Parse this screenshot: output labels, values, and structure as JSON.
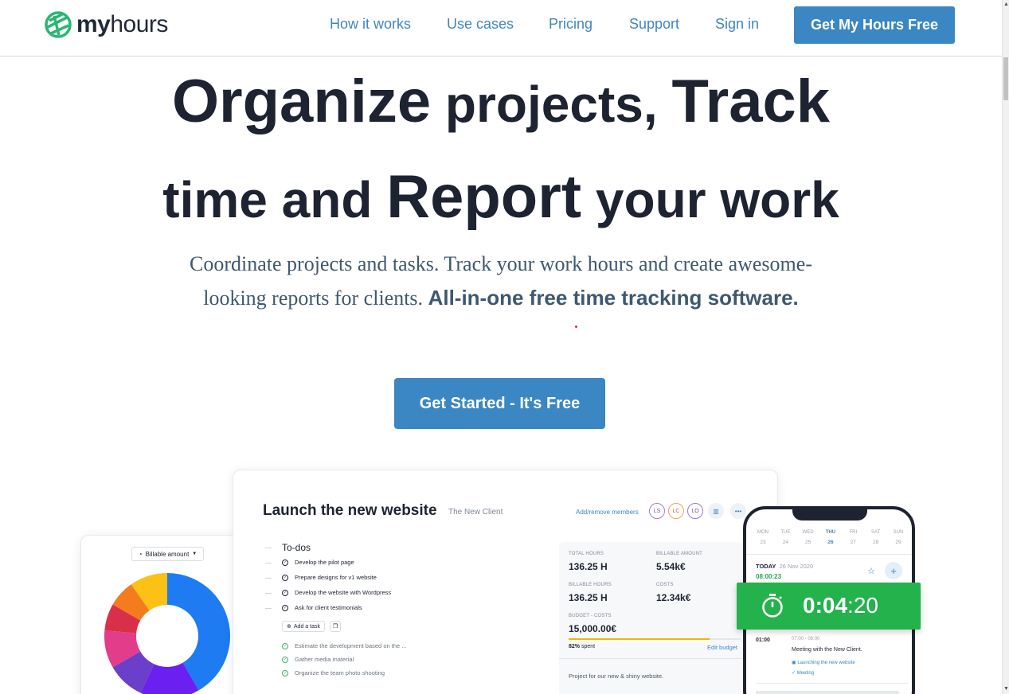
{
  "header": {
    "logo_bold": "my",
    "logo_light": "hours",
    "nav": [
      {
        "label": "How it works"
      },
      {
        "label": "Use cases"
      },
      {
        "label": "Pricing"
      },
      {
        "label": "Support"
      },
      {
        "label": "Sign in"
      }
    ],
    "cta": "Get My Hours Free"
  },
  "hero": {
    "line1_a": "Organize",
    "line1_b": " projects, ",
    "line1_c": "Track",
    "line2_a": "time and ",
    "line2_b": "Report",
    "line2_c": " your work",
    "subtitle_1": "Coordinate projects and tasks. Track your work hours and create awesome-",
    "subtitle_2": "looking reports for clients. ",
    "subtitle_bold": "All-in-one free time tracking software.",
    "cta": "Get Started - It's Free"
  },
  "mock": {
    "project_title": "Launch the new website",
    "client": "The New Client",
    "members_link": "Add/remove members",
    "avatars": [
      "LS",
      "LC",
      "LO"
    ],
    "todo_heading": "To-dos",
    "todos_open": [
      "Develop the pilot page",
      "Prepare designs for v1 website",
      "Develop the website with Wordpress",
      "Ask for client testimonials"
    ],
    "add_task": "Add a task",
    "todos_done": [
      "Estimate the development based on the ...",
      "Gather media material",
      "Organize the team photo shooting"
    ],
    "stats": {
      "total_hours_label": "TOTAL HOURS",
      "total_hours": "136.25 H",
      "billable_amount_label": "BILLABLE AMOUNT",
      "billable_amount": "5.54k€",
      "billable_hours_label": "BILLABLE HOURS",
      "billable_hours": "136.25 H",
      "costs_label": "COSTS",
      "costs": "12.34k€",
      "budget_label": "BUDGET - COSTS",
      "budget": "15,000.00€",
      "spent_pct": "82%",
      "spent_word": " spent",
      "spent_fraction": 0.82,
      "edit_budget": "Edit budget",
      "project_desc": "Project for our new & shiny website."
    },
    "donut_select": "Billable amount",
    "donut_colors": [
      "#1e7bf2",
      "#6b1ff0",
      "#6a3fc9",
      "#e23d8a",
      "#d9304a",
      "#f57b1f",
      "#fbc114",
      "#1e7bf2"
    ]
  },
  "phone": {
    "week": [
      {
        "day": "MON",
        "num": "23"
      },
      {
        "day": "TUE",
        "num": "24"
      },
      {
        "day": "WED",
        "num": "25"
      },
      {
        "day": "THU",
        "num": "26",
        "active": true
      },
      {
        "day": "FRI",
        "num": "27"
      },
      {
        "day": "SAT",
        "num": "28"
      },
      {
        "day": "SUN",
        "num": "29"
      }
    ],
    "today_label": "TODAY",
    "today_date": "26 Nov 2020",
    "today_total": "08:00:23",
    "entry_time": "01:00",
    "entry_range": "07:00 - 08:00",
    "entry_title": "Meeting with the New Client.",
    "entry_project": "Launching the new website",
    "entry_tag": "Meeting"
  },
  "timer": {
    "main": "0:04",
    "seconds": ":20"
  },
  "colors": {
    "brand_blue": "#3a87c3",
    "timer_green": "#24b24c",
    "logo_green": "#2bb673"
  }
}
